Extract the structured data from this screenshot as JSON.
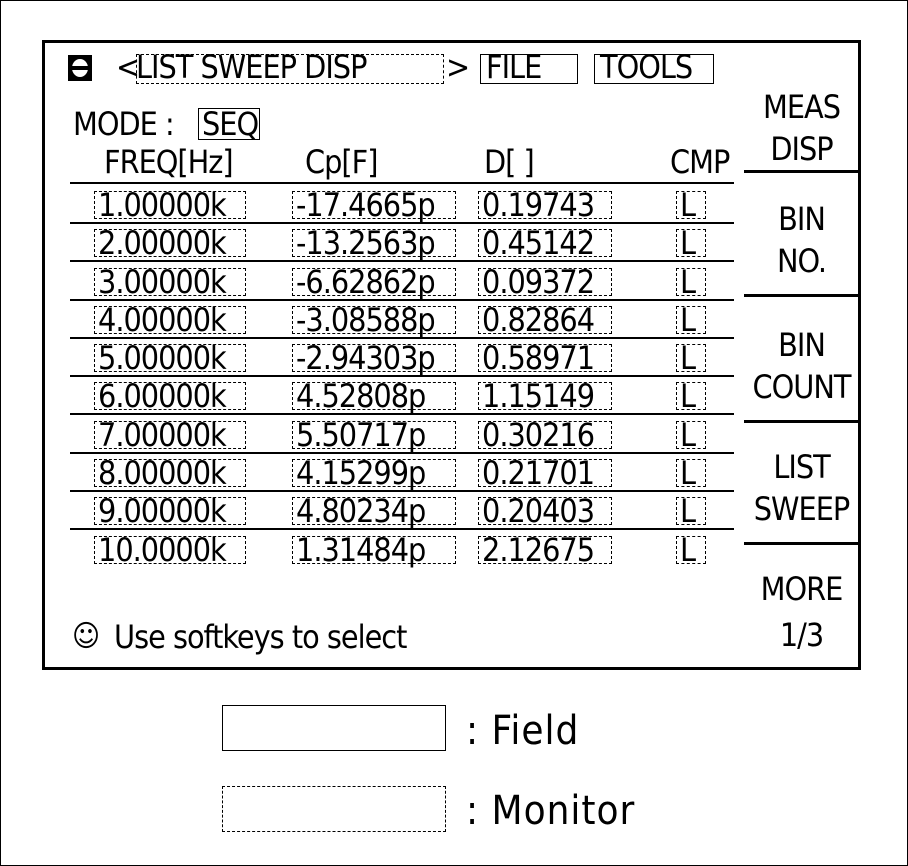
{
  "header": {
    "nav_prefix": "<",
    "nav_title": "LIST SWEEP DISP",
    "nav_suffix": ">",
    "file_label": "FILE",
    "tools_label": "TOOLS",
    "disk_icon": "disk-icon"
  },
  "mode": {
    "label": "MODE :",
    "value": "SEQ"
  },
  "table": {
    "columns": [
      "FREQ[Hz]",
      "Cp[F]",
      "D[ ]",
      "CMP"
    ],
    "rows": [
      {
        "freq": "1.00000k",
        "cp": "-17.4665p",
        "d": "0.19743",
        "cmp": "L"
      },
      {
        "freq": "2.00000k",
        "cp": "-13.2563p",
        "d": "0.45142",
        "cmp": "L"
      },
      {
        "freq": "3.00000k",
        "cp": "-6.62862p",
        "d": "0.09372",
        "cmp": "L"
      },
      {
        "freq": "4.00000k",
        "cp": "-3.08588p",
        "d": "0.82864",
        "cmp": "L"
      },
      {
        "freq": "5.00000k",
        "cp": "-2.94303p",
        "d": "0.58971",
        "cmp": "L"
      },
      {
        "freq": "6.00000k",
        "cp": "4.52808p",
        "d": "1.15149",
        "cmp": "L"
      },
      {
        "freq": "7.00000k",
        "cp": "5.50717p",
        "d": "0.30216",
        "cmp": "L"
      },
      {
        "freq": "8.00000k",
        "cp": "4.15299p",
        "d": "0.21701",
        "cmp": "L"
      },
      {
        "freq": "9.00000k",
        "cp": "4.80234p",
        "d": "0.20403",
        "cmp": "L"
      },
      {
        "freq": "10.0000k",
        "cp": "1.31484p",
        "d": "2.12675",
        "cmp": "L"
      }
    ]
  },
  "status": {
    "icon": "smiley-icon",
    "text": "Use softkeys to select"
  },
  "softkeys": [
    {
      "line1": "MEAS",
      "line2": "DISP"
    },
    {
      "line1": "BIN",
      "line2": "NO."
    },
    {
      "line1": "BIN",
      "line2": "COUNT"
    },
    {
      "line1": "LIST",
      "line2": "SWEEP"
    },
    {
      "line1": "MORE",
      "line2": "1/3"
    }
  ],
  "legend": {
    "field_label": ": Field",
    "monitor_label": ": Monitor"
  }
}
